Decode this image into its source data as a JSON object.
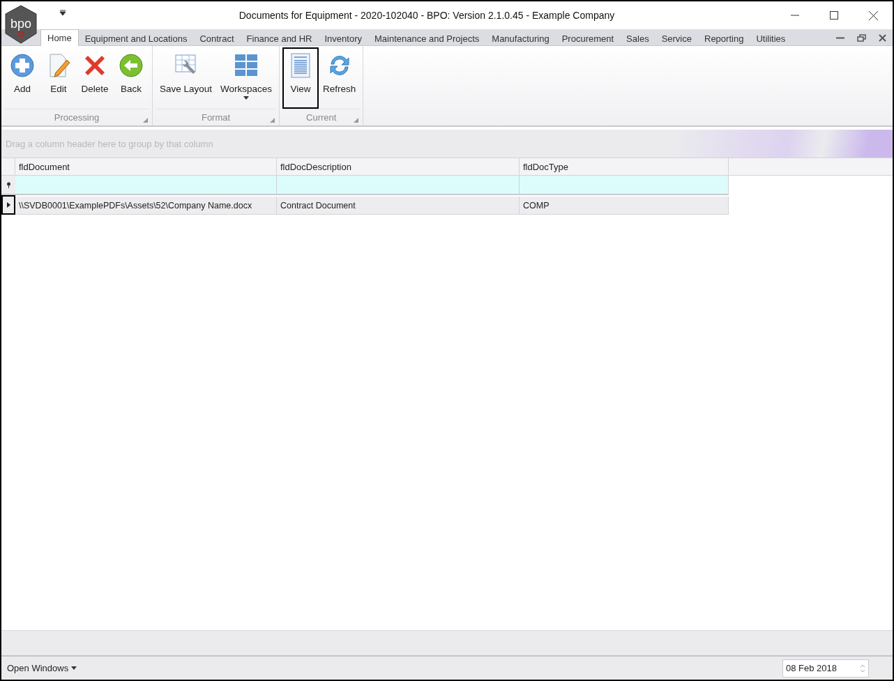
{
  "window": {
    "logo_text": "bpo",
    "title": "Documents for Equipment - 2020-102040 - BPO: Version 2.1.0.45 - Example Company"
  },
  "tabs": [
    {
      "label": "Home",
      "selected": true
    },
    {
      "label": "Equipment and Locations",
      "selected": false
    },
    {
      "label": "Contract",
      "selected": false
    },
    {
      "label": "Finance and HR",
      "selected": false
    },
    {
      "label": "Inventory",
      "selected": false
    },
    {
      "label": "Maintenance and Projects",
      "selected": false
    },
    {
      "label": "Manufacturing",
      "selected": false
    },
    {
      "label": "Procurement",
      "selected": false
    },
    {
      "label": "Sales",
      "selected": false
    },
    {
      "label": "Service",
      "selected": false
    },
    {
      "label": "Reporting",
      "selected": false
    },
    {
      "label": "Utilities",
      "selected": false
    }
  ],
  "ribbon_groups": [
    {
      "label": "Processing",
      "buttons": [
        {
          "label": "Add",
          "dropdown": false,
          "highlighted": false
        },
        {
          "label": "Edit",
          "dropdown": false,
          "highlighted": false
        },
        {
          "label": "Delete",
          "dropdown": false,
          "highlighted": false
        },
        {
          "label": "Back",
          "dropdown": false,
          "highlighted": false
        }
      ]
    },
    {
      "label": "Format",
      "buttons": [
        {
          "label": "Save Layout",
          "dropdown": false,
          "highlighted": false
        },
        {
          "label": "Workspaces",
          "dropdown": true,
          "highlighted": false
        }
      ]
    },
    {
      "label": "Current",
      "buttons": [
        {
          "label": "View",
          "dropdown": false,
          "highlighted": true
        },
        {
          "label": "Refresh",
          "dropdown": false,
          "highlighted": false
        }
      ]
    }
  ],
  "grid": {
    "group_panel_hint": "Drag a column header here to group by that column",
    "columns": [
      "fldDocument",
      "fldDocDescription",
      "fldDocType"
    ],
    "rows": [
      {
        "cells": [
          "\\\\SVDB0001\\ExamplePDFs\\Assets\\52\\Company Name.docx",
          "Contract Document",
          "COMP"
        ],
        "indicator_highlighted": true
      }
    ]
  },
  "status_bar": {
    "open_windows": "Open Windows",
    "date": "08 Feb 2018"
  }
}
